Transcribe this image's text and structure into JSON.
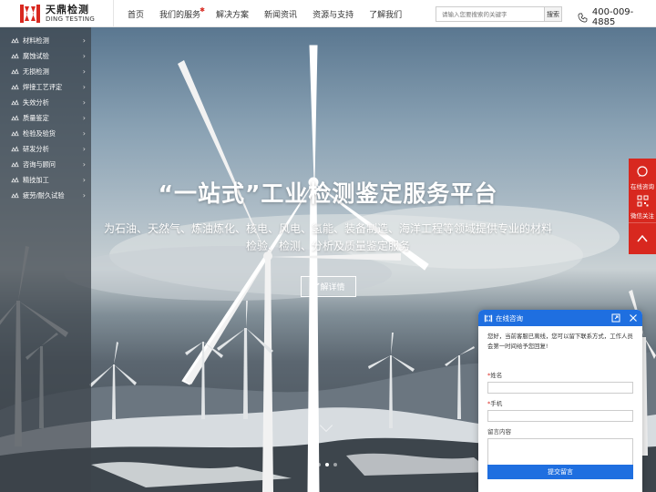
{
  "header": {
    "logo_cn": "天鼎检测",
    "logo_en": "DING TESTING",
    "nav": [
      "首页",
      "我们的服务",
      "解决方案",
      "新闻资讯",
      "资源与支持",
      "了解我们"
    ],
    "search_placeholder": "请输入您要搜索的关键字",
    "search_button": "搜索",
    "phone": "400-009-4885"
  },
  "sidebar": {
    "items": [
      {
        "label": "材料检测"
      },
      {
        "label": "腐蚀试验"
      },
      {
        "label": "无损检测"
      },
      {
        "label": "焊接工艺评定"
      },
      {
        "label": "失效分析"
      },
      {
        "label": "质量鉴定"
      },
      {
        "label": "检验及验货"
      },
      {
        "label": "研发分析"
      },
      {
        "label": "咨询与顾问"
      },
      {
        "label": "精技加工"
      },
      {
        "label": "疲劳/耐久试验"
      }
    ]
  },
  "hero": {
    "title": "“一站式”工业检测鉴定服务平台",
    "subtitle_line1": "为石油、天然气、炼油炼化、核电、风电、氢能、装备制造、海洋工程等领域提供专业的材料",
    "subtitle_line2": "检验、检测、分析及质量鉴定服务",
    "button": "了解详情",
    "slide_count": 3,
    "active_slide": 2
  },
  "float_bar": {
    "consult_label": "在线咨询",
    "wechat_label": "微信关注"
  },
  "chat": {
    "title": "在线咨询",
    "message": "您好，当前客服已离线，您可以留下联系方式，工作人员会第一时间给予您回复!",
    "name_label": "姓名",
    "phone_label": "手机",
    "message_label": "留言内容",
    "submit": "提交留言"
  },
  "colors": {
    "brand_red": "#d8281f",
    "chat_blue": "#1f6fe0"
  }
}
